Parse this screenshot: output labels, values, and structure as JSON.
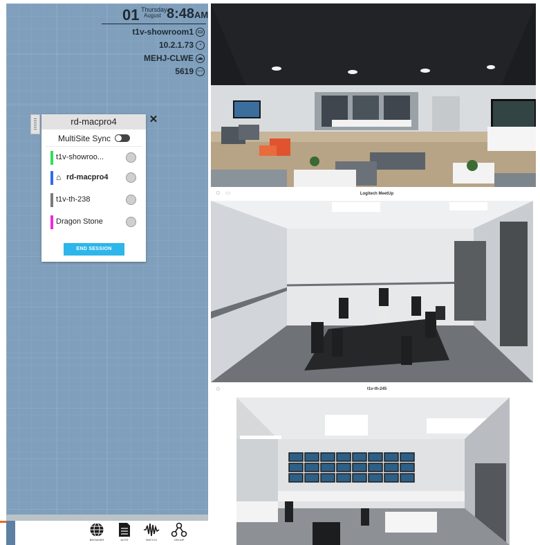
{
  "clock": {
    "day": "01",
    "weekday": "Thursday",
    "month": "August",
    "time": "8:48",
    "ampm": "AM"
  },
  "status": {
    "room_name": "t1v-showroom1",
    "ip_address": "10.2.1.73",
    "room_code": "MEHJ-CLWE",
    "pin": "5619",
    "room_icon": "monitor-icon",
    "ip_icon": "wifi-icon",
    "code_icon": "cloud-icon",
    "pin_icon": "dots-icon"
  },
  "session_panel": {
    "title": "rd-macpro4",
    "multisite_sync_label": "MultiSite Sync",
    "multisite_sync_on": false,
    "sites": [
      {
        "label": "t1v-showroo...",
        "color": "#2ee05a",
        "is_host": false
      },
      {
        "label": "rd-macpro4",
        "color": "#2f6bf0",
        "is_host": true
      },
      {
        "label": "t1v-th-238",
        "color": "#7a7a7a",
        "is_host": false
      },
      {
        "label": "Dragon Stone",
        "color": "#ee2bd8",
        "is_host": false
      }
    ],
    "end_session_label": "END SESSION",
    "close_glyph": "✕"
  },
  "feeds": [
    {
      "label": "Logitech MeetUp"
    },
    {
      "label": "t1v-th-245"
    },
    {
      "label": ""
    }
  ],
  "toolbar": {
    "items": [
      {
        "icon": "globe-icon",
        "label": "BROWSER"
      },
      {
        "icon": "document-icon",
        "label": "NOTE"
      },
      {
        "icon": "waveform-icon",
        "label": "SKETCH"
      },
      {
        "icon": "nodes-icon",
        "label": "GROUP"
      }
    ]
  },
  "colors": {
    "canvas": "#7f9fbc",
    "accent": "#2db6ea",
    "accent_orange": "#e86b1f"
  }
}
